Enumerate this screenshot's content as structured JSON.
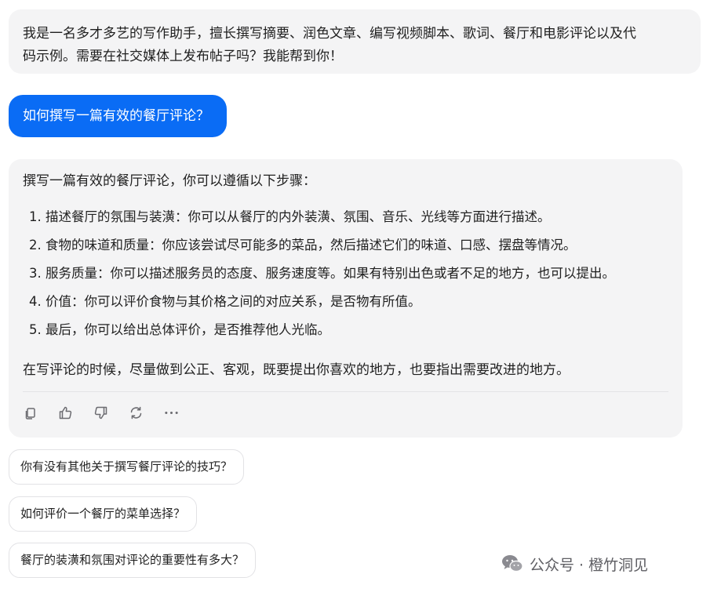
{
  "intro_message": {
    "line1": "我是一名多才多艺的写作助手，擅长撰写摘要、润色文章、编写视频脚本、歌词、餐厅和电影评论以及代",
    "line2": "码示例。需要在社交媒体上发布帖子吗？我能帮到你！"
  },
  "user_message": "如何撰写一篇有效的餐厅评论？",
  "answer": {
    "intro": "撰写一篇有效的餐厅评论，你可以遵循以下步骤：",
    "steps": [
      "1. 描述餐厅的氛围与装潢：你可以从餐厅的内外装潢、氛围、音乐、光线等方面进行描述。",
      "2. 食物的味道和质量：你应该尝试尽可能多的菜品，然后描述它们的味道、口感、摆盘等情况。",
      "3. 服务质量：你可以描述服务员的态度、服务速度等。如果有特别出色或者不足的地方，也可以提出。",
      "4. 价值：你可以评价食物与其价格之间的对应关系，是否物有所值。",
      "5. 最后，你可以给出总体评价，是否推荐他人光临。"
    ],
    "outro": "在写评论的时候，尽量做到公正、客观，既要提出你喜欢的地方，也要指出需要改进的地方。"
  },
  "actions": [
    {
      "icon": "copy-icon"
    },
    {
      "icon": "thumbs-up-icon"
    },
    {
      "icon": "thumbs-down-icon"
    },
    {
      "icon": "refresh-icon"
    },
    {
      "icon": "more-icon"
    }
  ],
  "suggestions": [
    "你有没有其他关于撰写餐厅评论的技巧？",
    "如何评价一个餐厅的菜单选择？",
    "餐厅的装潢和氛围对评论的重要性有多大？"
  ],
  "watermark": {
    "icon": "wechat-icon",
    "text": "公众号 · 橙竹洞见"
  },
  "colors": {
    "user_bubble": "#0a6cf5",
    "assistant_bubble": "#f4f4f5",
    "text": "#1f1f1f"
  }
}
